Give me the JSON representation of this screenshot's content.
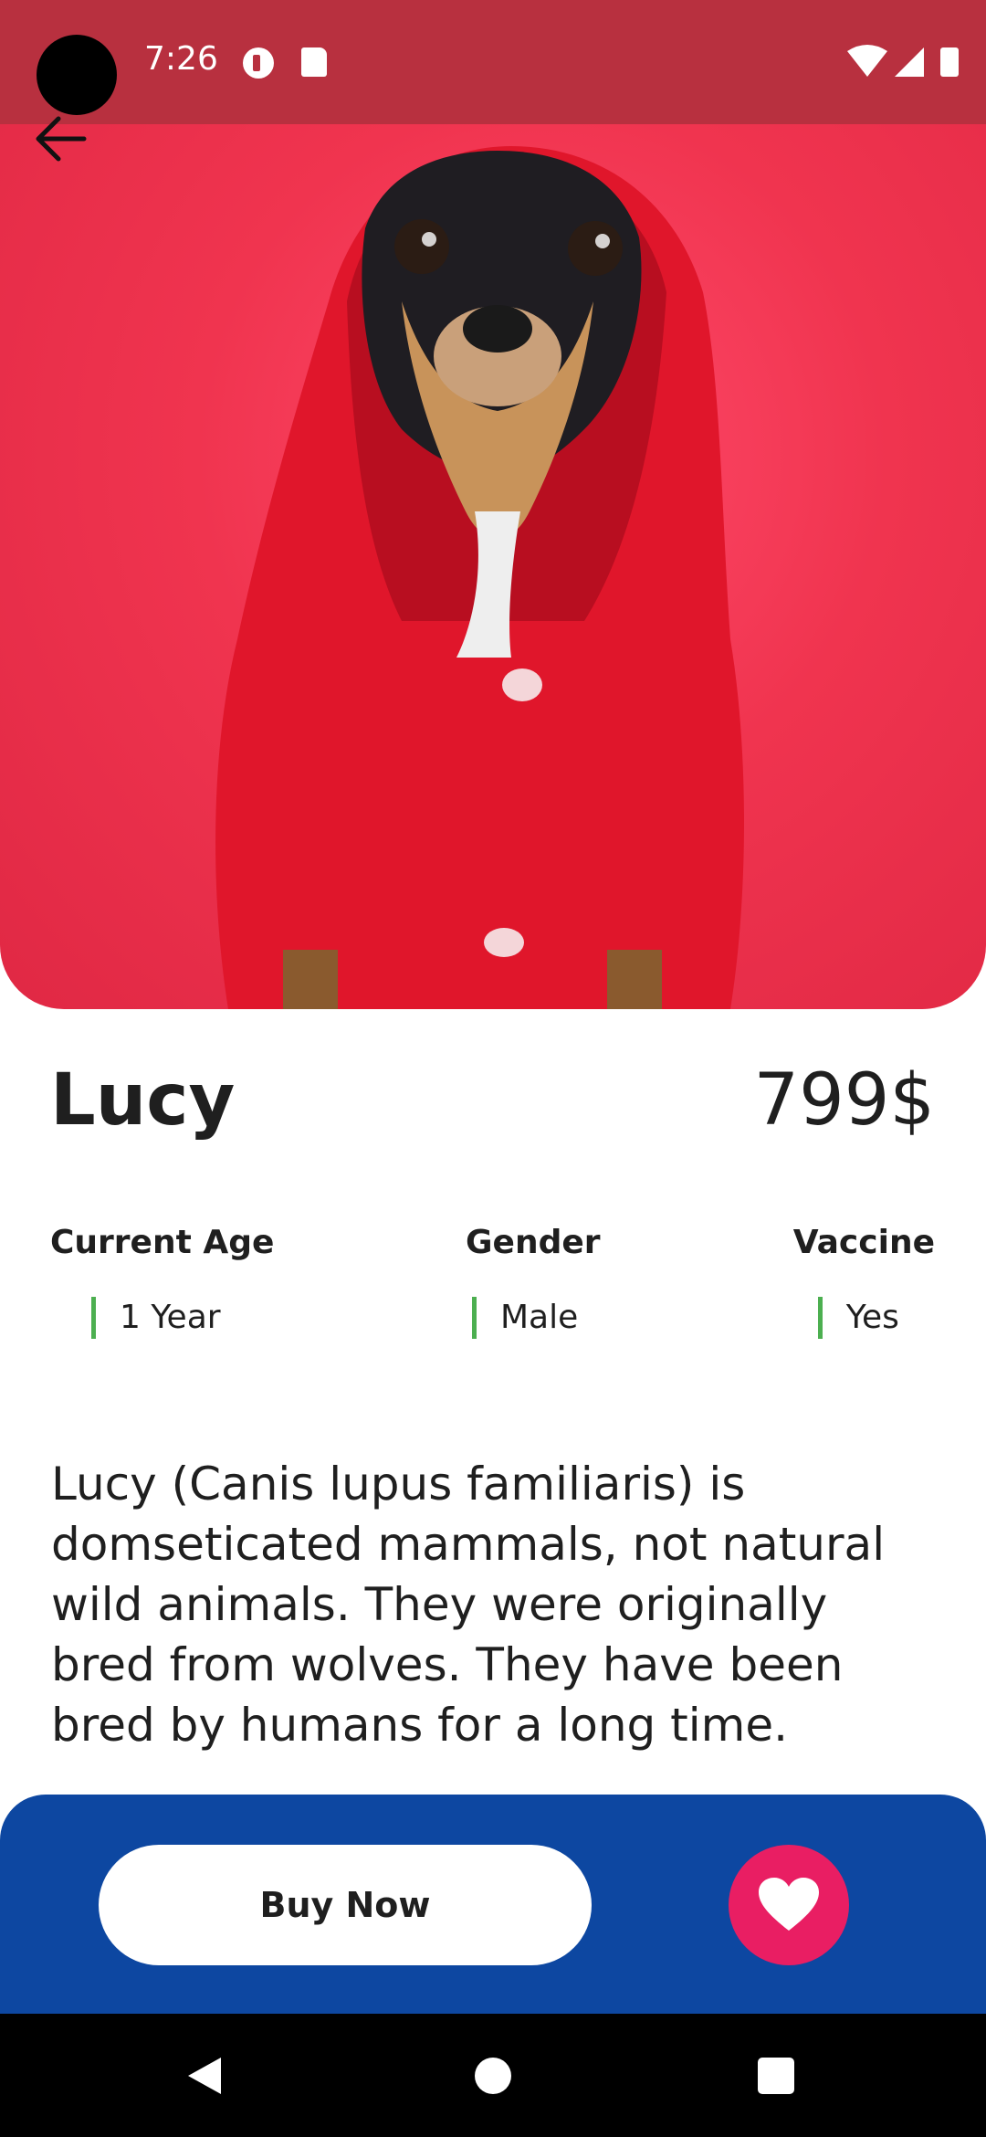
{
  "status_bar": {
    "time": "7:26",
    "icons": [
      "camera-cutout",
      "app-notification-icon",
      "sd-card-icon",
      "wifi-icon",
      "signal-icon",
      "battery-icon"
    ]
  },
  "header": {
    "back_icon": "arrow-left-icon"
  },
  "hero": {
    "image_subject": "dog-in-red-hoodie"
  },
  "pet": {
    "name": "Lucy",
    "price": "799$"
  },
  "info": {
    "age": {
      "label": "Current Age",
      "value": "1 Year"
    },
    "gender": {
      "label": "Gender",
      "value": "Male"
    },
    "vaccine": {
      "label": "Vaccine",
      "value": "Yes"
    }
  },
  "description": "Lucy (Canis lupus familiaris) is domseticated mammals, not natural wild animals. They were originally bred from wolves. They have been bred by humans for a long time.",
  "actions": {
    "buy_label": "Buy Now",
    "favorite_icon": "heart-icon"
  },
  "colors": {
    "status_bar": "#b8303f",
    "hero_background": "#f0344f",
    "accent_green": "#4caf50",
    "action_bar": "#0d47a1",
    "favorite": "#e91e63"
  }
}
